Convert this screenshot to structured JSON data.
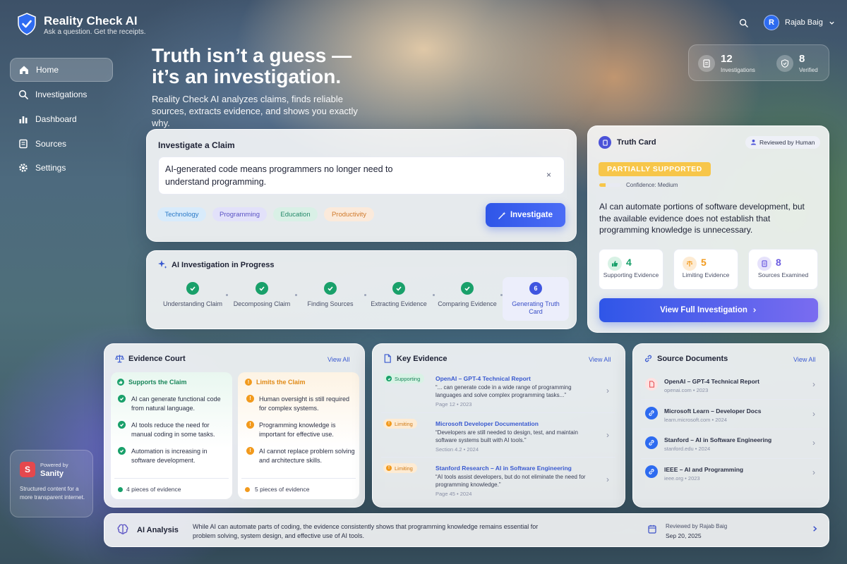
{
  "brand": {
    "title": "Reality Check AI",
    "subtitle": "Ask a question. Get the receipts."
  },
  "sidebar": {
    "items": [
      {
        "label": "Home",
        "icon": "home-icon",
        "active": true
      },
      {
        "label": "Investigations",
        "icon": "search-icon",
        "active": false
      },
      {
        "label": "Dashboard",
        "icon": "bar-chart-icon",
        "active": false
      },
      {
        "label": "Sources",
        "icon": "folder-icon",
        "active": false
      },
      {
        "label": "Settings",
        "icon": "gear-icon",
        "active": false
      }
    ],
    "powered": {
      "label": "Powered by",
      "name": "Sanity",
      "tagline": "Structured content for a more transparent internet."
    }
  },
  "hero": {
    "title_line1": "Truth isn’t a guess —",
    "title_line2": "it’s an investigation.",
    "description": "Reality Check AI analyzes claims, finds reliable sources, extracts evidence, and shows you exactly why."
  },
  "header": {
    "user_initial": "R",
    "user_name": "Rajab Baig",
    "stats": [
      {
        "value": "12",
        "label": "Investigations"
      },
      {
        "value": "8",
        "label": "Verified"
      }
    ]
  },
  "claim": {
    "heading": "Investigate a Claim",
    "text": "AI-generated code means programmers no longer need to understand programming.",
    "clear_symbol": "×",
    "tags": [
      "Technology",
      "Programming",
      "Education",
      "Productivity"
    ],
    "button": "Investigate"
  },
  "progress": {
    "heading": "AI Investigation in Progress",
    "steps": [
      {
        "label": "Understanding Claim",
        "done": true
      },
      {
        "label": "Decomposing Claim",
        "done": true
      },
      {
        "label": "Finding Sources",
        "done": true
      },
      {
        "label": "Extracting Evidence",
        "done": true
      },
      {
        "label": "Comparing Evidence",
        "done": true
      },
      {
        "label": "Generating Truth Card",
        "done": false,
        "number": "6"
      }
    ]
  },
  "truth_card": {
    "heading": "Truth Card",
    "reviewed": "Reviewed by Human",
    "verdict": "PARTIALLY SUPPORTED",
    "confidence": "Confidence: Medium",
    "confidence_level": 0.3,
    "summary": "AI can automate portions of software development, but the available evidence does not establish that programming knowledge is unnecessary.",
    "stats": [
      {
        "value": "4",
        "label": "Supporting Evidence",
        "color": "#19a06a"
      },
      {
        "value": "5",
        "label": "Limiting Evidence",
        "color": "#f29a1d"
      },
      {
        "value": "8",
        "label": "Sources Examined",
        "color": "#6b5be0"
      }
    ],
    "button": "View Full Investigation"
  },
  "evidence_court": {
    "heading": "Evidence Court",
    "view_all": "View All",
    "supports": {
      "title": "Supports the Claim",
      "items": [
        "AI can generate functional code from natural language.",
        "AI tools reduce the need for manual coding in some tasks.",
        "Automation is increasing in software development."
      ],
      "footer": "4 pieces of evidence"
    },
    "limits": {
      "title": "Limits the Claim",
      "items": [
        "Human oversight is still required for complex systems.",
        "Programming knowledge is important for effective use.",
        "AI cannot replace problem solving and architecture skills."
      ],
      "footer": "5 pieces of evidence"
    }
  },
  "key_evidence": {
    "heading": "Key Evidence",
    "view_all": "View All",
    "items": [
      {
        "badge": "Supporting",
        "title": "OpenAI – GPT-4 Technical Report",
        "quote": "“... can generate code in a wide range of programming languages and solve complex programming tasks...”",
        "meta": "Page 12  •  2023"
      },
      {
        "badge": "Limiting",
        "title": "Microsoft Developer Documentation",
        "quote": "“Developers are still needed to design, test, and maintain software systems built with AI tools.”",
        "meta": "Section 4.2  •  2024"
      },
      {
        "badge": "Limiting",
        "title": "Stanford Research – AI in Software Engineering",
        "quote": "“AI tools assist developers, but do not eliminate the need for programming knowledge.”",
        "meta": "Page 45  •  2024"
      }
    ]
  },
  "source_documents": {
    "heading": "Source Documents",
    "view_all": "View All",
    "items": [
      {
        "title": "OpenAI – GPT-4 Technical Report",
        "meta": "openai.com  •  2023",
        "icon": "pdf-icon"
      },
      {
        "title": "Microsoft Learn – Developer Docs",
        "meta": "learn.microsoft.com  •  2024",
        "icon": "link-icon"
      },
      {
        "title": "Stanford – AI in Software Engineering",
        "meta": "stanford.edu  •  2024",
        "icon": "link-icon"
      },
      {
        "title": "IEEE – AI and Programming",
        "meta": "ieee.org  •  2023",
        "icon": "link-icon"
      }
    ]
  },
  "analysis": {
    "heading": "AI Analysis",
    "text": "While AI can automate parts of coding, the evidence consistently shows that programming knowledge remains essential for problem solving, system design, and effective use of AI tools.",
    "reviewed_by": "Reviewed by Rajab Baig",
    "date": "Sep 20, 2025"
  },
  "colors": {
    "accent": "#2f56e8",
    "supporting": "#19a06a",
    "limiting": "#f29a1d",
    "verdict": "#f7c64a"
  }
}
